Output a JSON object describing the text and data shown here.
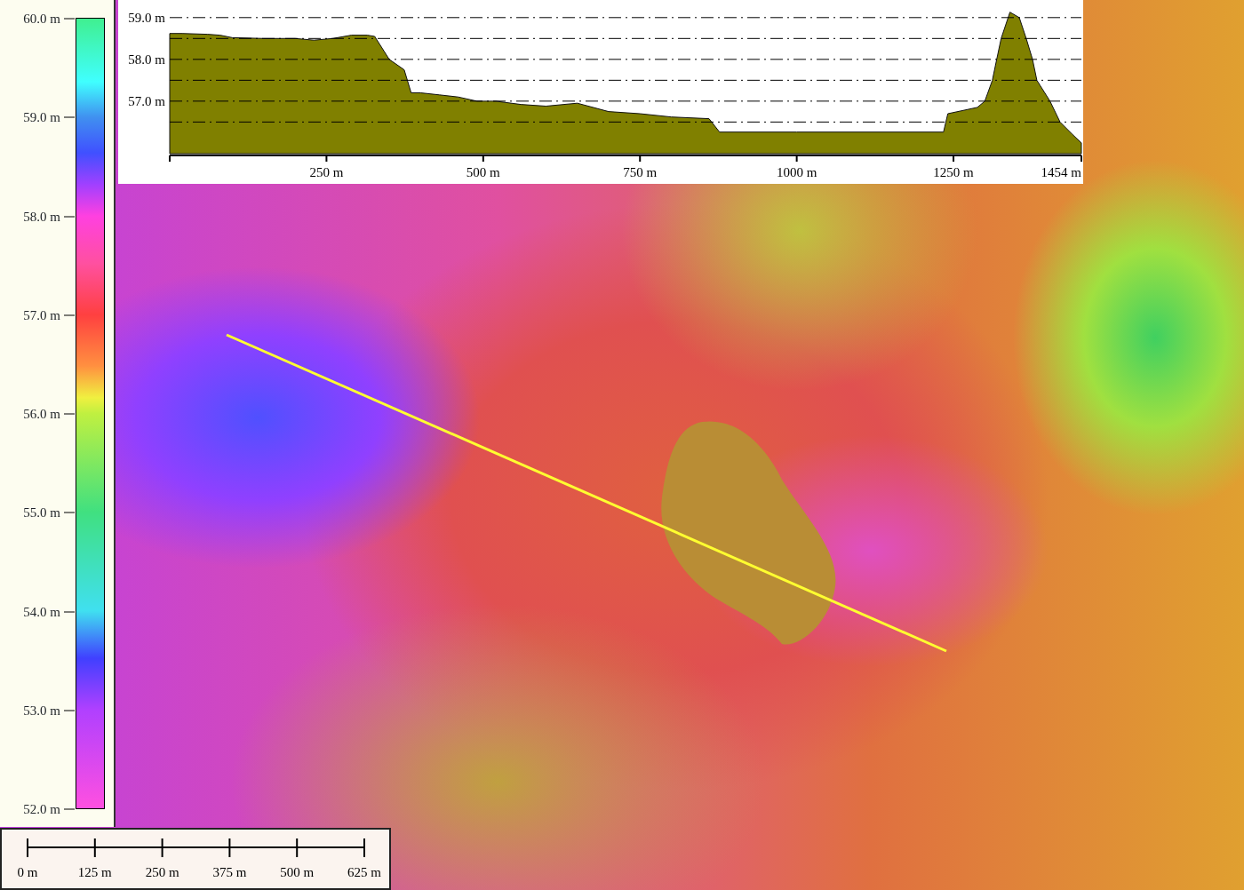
{
  "legend": {
    "labels": [
      "60.0 m",
      "59.0 m",
      "58.0 m",
      "57.0 m",
      "56.0 m",
      "55.0 m",
      "54.0 m",
      "53.0 m",
      "52.0 m"
    ]
  },
  "profile": {
    "chart_data": {
      "type": "area",
      "x": [
        0,
        20,
        60,
        80,
        100,
        150,
        200,
        230,
        260,
        290,
        315,
        327,
        350,
        374,
        385,
        400,
        430,
        460,
        490,
        520,
        560,
        600,
        650,
        700,
        750,
        800,
        860,
        877,
        1000,
        1234,
        1241,
        1288,
        1300,
        1312,
        1319,
        1326,
        1340,
        1355,
        1366,
        1376,
        1383,
        1404,
        1420,
        1440,
        1454
      ],
      "series": [
        {
          "color": "#808000",
          "values": [
            58.62,
            58.62,
            58.6,
            58.58,
            58.52,
            58.5,
            58.5,
            58.46,
            58.5,
            58.58,
            58.58,
            58.55,
            58.0,
            57.75,
            57.2,
            57.2,
            57.15,
            57.1,
            57.0,
            57.0,
            56.92,
            56.88,
            56.95,
            56.75,
            56.7,
            56.62,
            56.58,
            56.26,
            56.26,
            56.26,
            56.7,
            56.85,
            57.0,
            57.5,
            58.0,
            58.5,
            59.13,
            59.0,
            58.5,
            58.0,
            57.5,
            57.0,
            56.5,
            56.2,
            56.0
          ]
        }
      ],
      "grid": true,
      "xlim": [
        0,
        1454
      ],
      "ylim": [
        55.7,
        59.4
      ],
      "xticks": [
        {
          "value": 250,
          "label": "250 m"
        },
        {
          "value": 500,
          "label": "500 m"
        },
        {
          "value": 750,
          "label": "750 m"
        },
        {
          "value": 1000,
          "label": "1000 m"
        },
        {
          "value": 1250,
          "label": "1250 m"
        },
        {
          "value": 1454,
          "label": "1454 m"
        }
      ],
      "yticks": [
        {
          "value": 57,
          "label": "57.0 m"
        },
        {
          "value": 58,
          "label": "58.0 m"
        },
        {
          "value": 59,
          "label": "59.0 m"
        }
      ]
    }
  },
  "scale_bar": {
    "labels": [
      "0 m",
      "125 m",
      "250 m",
      "375 m",
      "500 m",
      "625 m"
    ]
  }
}
